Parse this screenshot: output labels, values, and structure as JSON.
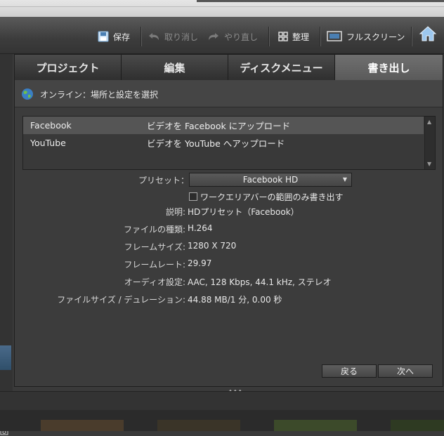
{
  "toolbar": {
    "save": "保存",
    "undo": "取り消し",
    "redo": "やり直し",
    "organize": "整理",
    "fullscreen": "フルスクリーン"
  },
  "tabs": [
    "プロジェクト",
    "編集",
    "ディスクメニュー",
    "書き出し"
  ],
  "header": {
    "title": "オンライン：場所と設定を選択"
  },
  "destinations": [
    {
      "name": "Facebook",
      "desc": "ビデオを Facebook にアップロード"
    },
    {
      "name": "YouTube",
      "desc": "ビデオを YouTube へアップロード"
    }
  ],
  "settings": {
    "preset_label": "プリセット：",
    "preset_value": "Facebook HD",
    "workarea_label": "ワークエリアバーの範囲のみ書き出す",
    "desc_label": "説明:",
    "desc_value": "HDプリセット（Facebook）",
    "filetype_label": "ファイルの種類:",
    "filetype_value": "H.264",
    "framesize_label": "フレームサイズ:",
    "framesize_value": "1280 X 720",
    "framerate_label": "フレームレート:",
    "framerate_value": "29.97",
    "audio_label": "オーディオ設定:",
    "audio_value": "AAC, 128 Kbps, 44.1 kHz, ステレオ",
    "filesize_label": "ファイルサイズ / デュレーション:",
    "filesize_value": "44.88 MB/1 分, 0.00 秒"
  },
  "buttons": {
    "back": "戻る",
    "next": "次へ"
  },
  "colors": {
    "panel_bg": "#3c3c3c",
    "active_tab": "#5f5f5f",
    "selected_row": "#555555"
  }
}
